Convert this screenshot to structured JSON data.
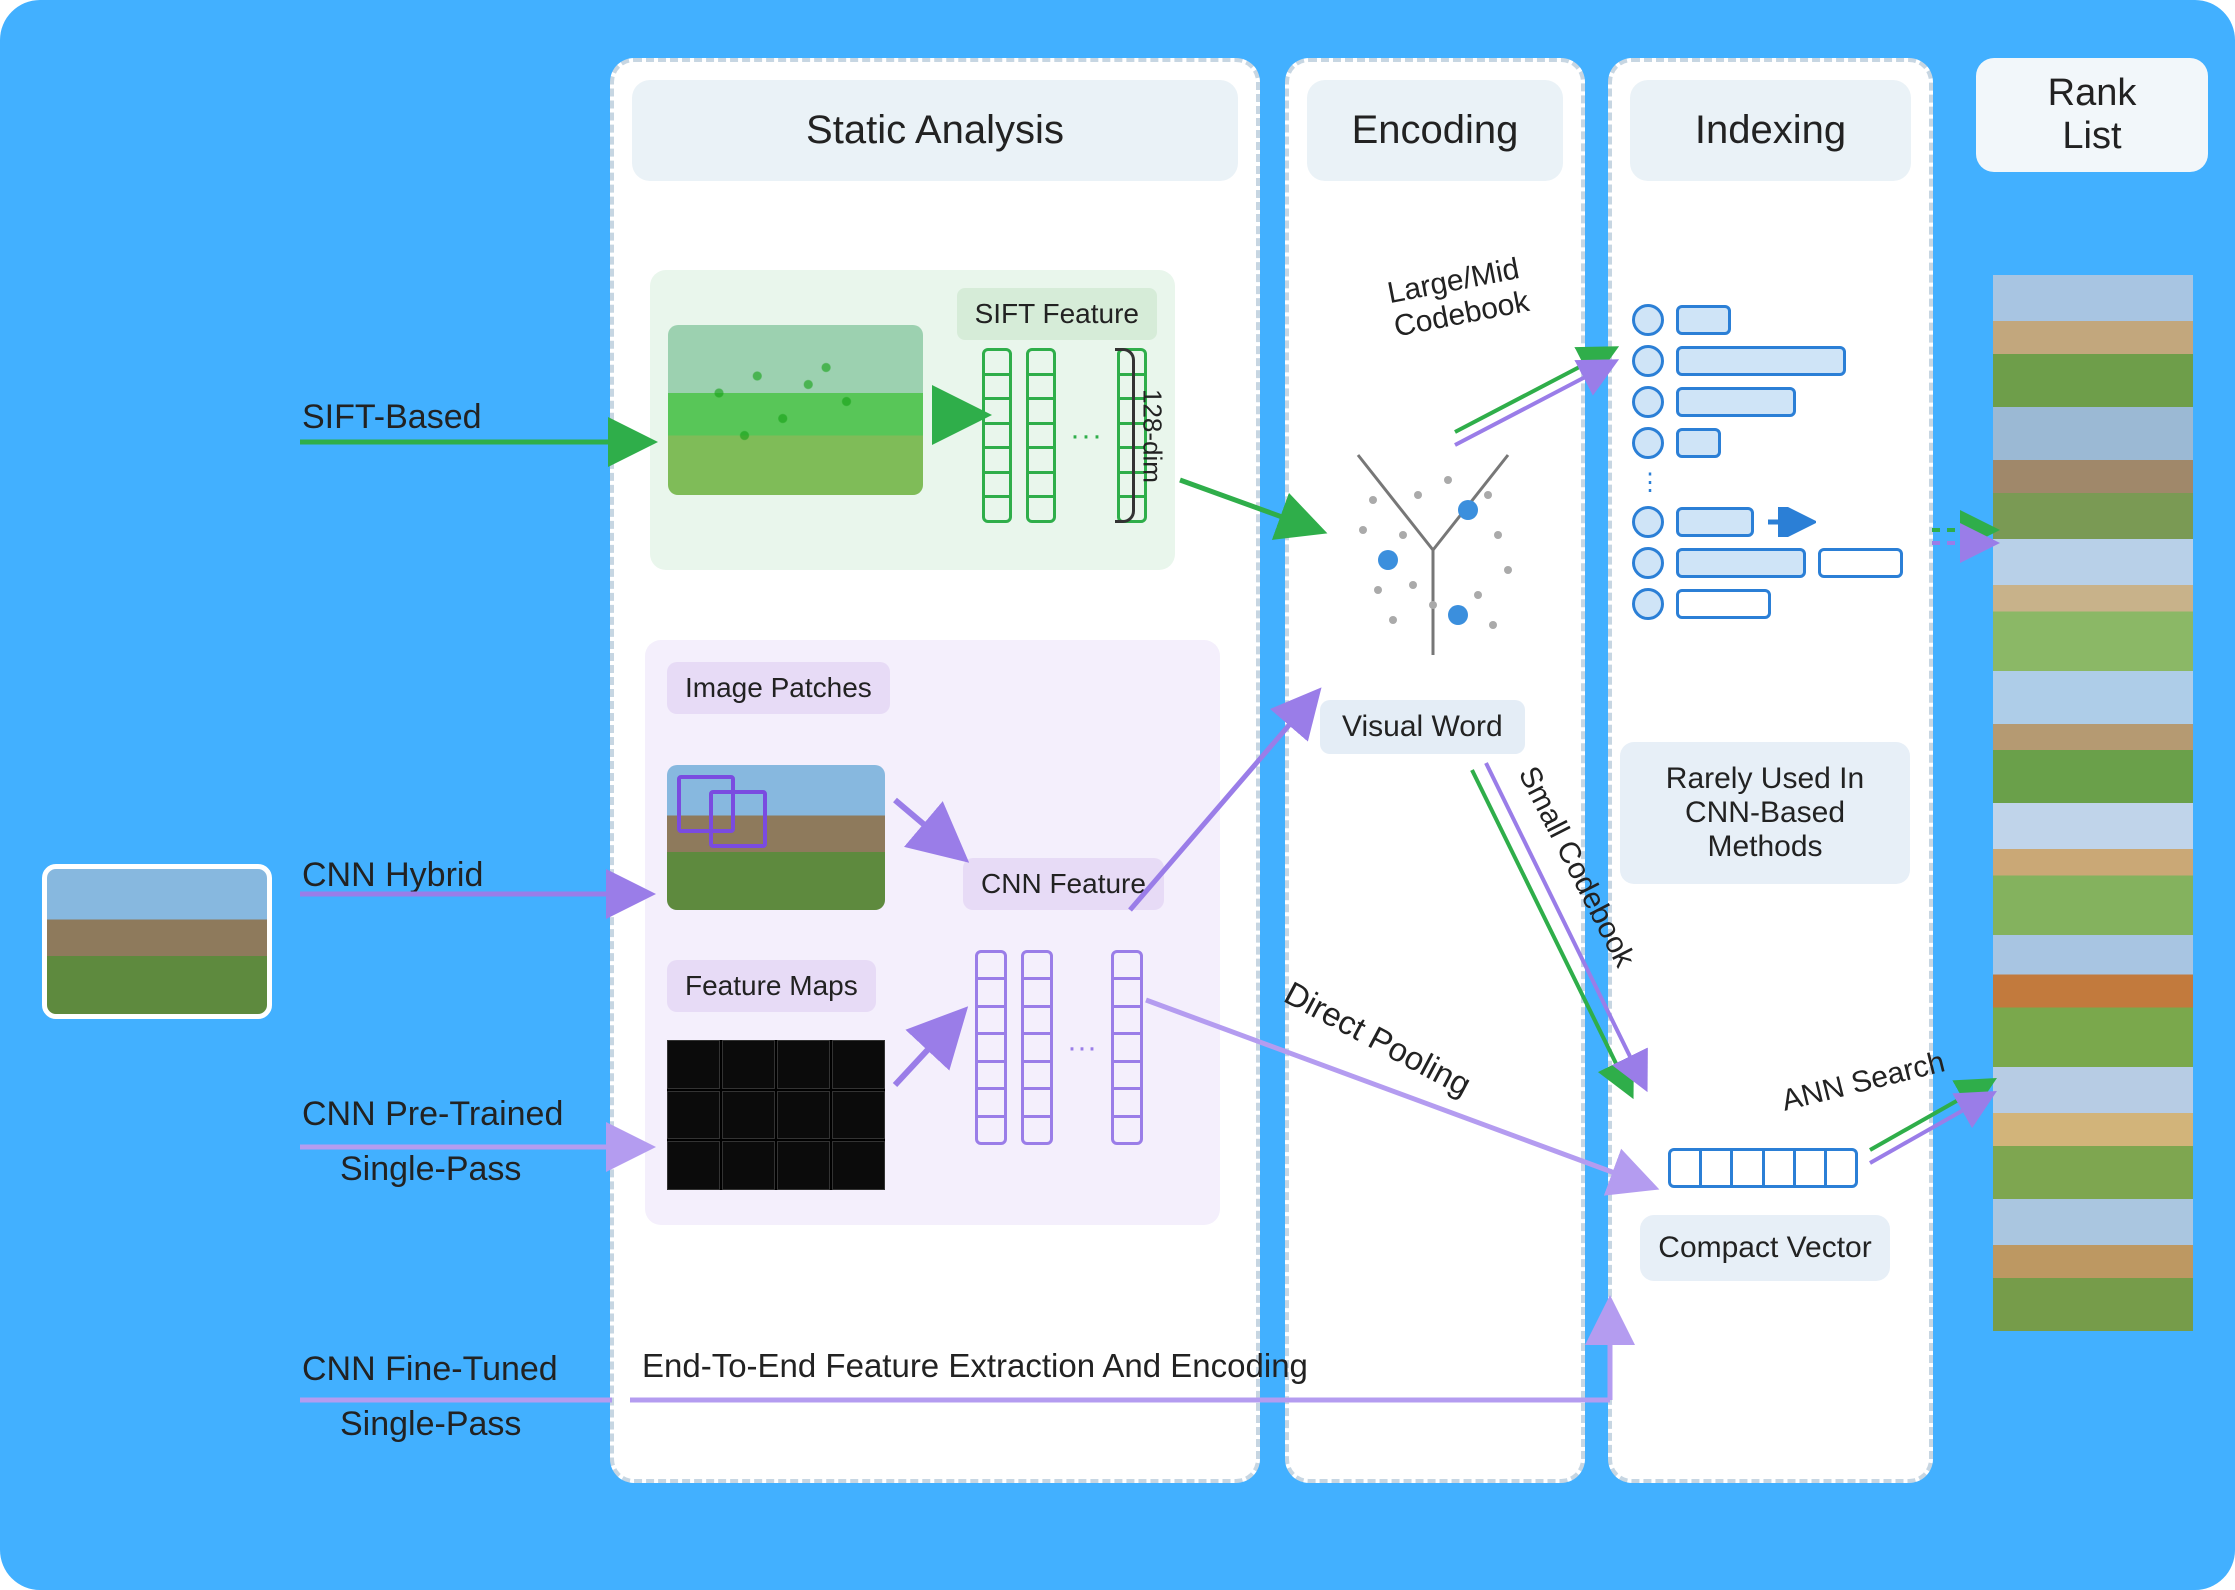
{
  "panels": {
    "static_analysis": "Static Analysis",
    "encoding": "Encoding",
    "indexing": "Indexing",
    "rank_list_l1": "Rank",
    "rank_list_l2": "List"
  },
  "pipelines": {
    "sift": "SIFT-Based",
    "hybrid": "CNN Hybrid",
    "pretrained_l1": "CNN Pre-Trained",
    "pretrained_l2": "Single-Pass",
    "finetuned_l1": "CNN Fine-Tuned",
    "finetuned_l2": "Single-Pass"
  },
  "sift": {
    "feature_label": "SIFT Feature",
    "dim_label": "128-dim"
  },
  "cnn": {
    "patches_label": "Image Patches",
    "feature_label": "CNN Feature",
    "fmaps_label": "Feature Maps"
  },
  "encoding": {
    "large_mid_l1": "Large/Mid",
    "large_mid_l2": "Codebook",
    "visual_word": "Visual Word",
    "small_codebook": "Small Codebook",
    "direct_pooling": "Direct Pooling",
    "end_to_end": "End-To-End Feature Extraction And Encoding"
  },
  "indexing": {
    "rarely_used": "Rarely Used In CNN-Based Methods",
    "compact_vector": "Compact Vector",
    "ann_search": "ANN Search"
  },
  "colors": {
    "bg": "#42b0ff",
    "sift_green": "#2fae4a",
    "cnn_purple": "#9a7de8",
    "idx_blue": "#2b7fd6"
  }
}
